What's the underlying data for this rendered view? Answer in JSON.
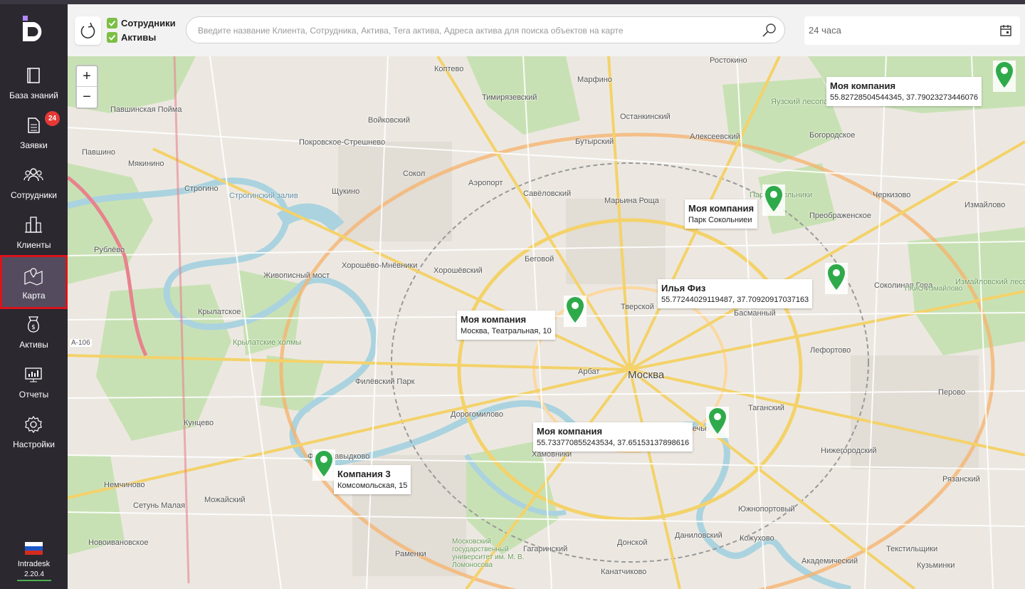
{
  "sidebar": {
    "items": [
      {
        "label": "База знаний"
      },
      {
        "label": "Заявки",
        "badge": "24"
      },
      {
        "label": "Сотрудники"
      },
      {
        "label": "Клиенты"
      },
      {
        "label": "Карта"
      },
      {
        "label": "Активы"
      },
      {
        "label": "Отчеты"
      },
      {
        "label": "Настройки"
      }
    ],
    "brand": "Intradesk",
    "version": "2.20.4"
  },
  "toolbar": {
    "filters": [
      {
        "label": "Сотрудники",
        "checked": true
      },
      {
        "label": "Активы",
        "checked": true
      }
    ],
    "search_placeholder": "Введите название Клиента, Сотрудника, Актива, Тега актива, Адреса актива для поиска объектов на карте",
    "period": "24 часа"
  },
  "map": {
    "zoom_in": "+",
    "zoom_out": "−",
    "markers": [
      {
        "title": "Моя компания",
        "subtitle": "55.82728504544345, 37.79023273446076"
      },
      {
        "title": "Моя компания",
        "subtitle": "Парк Сокольниеи"
      },
      {
        "title": "Илья Физ",
        "subtitle": "55.77244029119487, 37.70920917037163"
      },
      {
        "title": "Моя компания",
        "subtitle": "Москва, Театральная, 10"
      },
      {
        "title": "Моя компания",
        "subtitle": "55.733770855243534, 37.65153137898616"
      },
      {
        "title": "Компания 3",
        "subtitle": "Комсомольская, 15"
      }
    ],
    "places": [
      "Коптево",
      "Марфино",
      "Ростокино",
      "Тимирязевский",
      "Войковский",
      "Останкинский",
      "Алексеевский",
      "Бутырский",
      "Богородское",
      "Павшинская Пойма",
      "Покровское-Стрешнево",
      "Сокол",
      "Аэропорт",
      "Савёловский",
      "Марьина Роща",
      "Строгино",
      "Щукино",
      "Мякинино",
      "Павшино",
      "Черкизово",
      "Измайлово",
      "Преображенское",
      "Рублёво",
      "Хорошёво-Мнёвники",
      "Хорошёвский",
      "Беговой",
      "Живописный мост",
      "Крылатское",
      "Филёвский Парк",
      "Тверской",
      "Басманный",
      "Соколиная Гора",
      "Лефортово",
      "Москва",
      "Арбат",
      "Таганский",
      "Перово",
      "Кунцево",
      "Дорогомилово",
      "Хамовники",
      "Нижегородский",
      "Рязанский",
      "Можайский",
      "Немчиново",
      "Сетунь Малая",
      "Новоивановское",
      "Южнопортовый",
      "Даниловский",
      "Кожухово",
      "Донской",
      "Раменки",
      "Гагаринский",
      "Академический",
      "Текстильщики",
      "Канатчиково",
      "Кузьминки",
      "Фили-Давыдково",
      "Замоскворечье",
      "Строгинский залив",
      "Крылатские холмы",
      "Измайловский лесопарк",
      "Яузский лесопарк",
      "Московский государственный университет им. М. В. Ломоносова",
      "Парк Сокольники",
      "ПКиО Измайлово",
      "А-106"
    ]
  }
}
